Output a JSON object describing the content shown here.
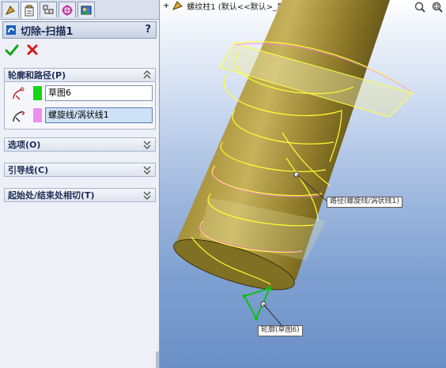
{
  "panel": {
    "tabs": [
      {
        "name": "feature-manager-tab-icon",
        "active": false
      },
      {
        "name": "property-manager-tab-icon",
        "active": true
      },
      {
        "name": "configuration-manager-tab-icon",
        "active": false
      },
      {
        "name": "dimxpert-tab-icon",
        "active": false
      },
      {
        "name": "display-manager-tab-icon",
        "active": false
      }
    ],
    "title": "切除-扫描1",
    "help": "?",
    "groups": {
      "profile_path": {
        "label": "轮廓和路径(P)",
        "profile_value": "草图6",
        "path_value": "螺旋线/涡状线1",
        "profile_color": "#16d416",
        "path_color": "#ee8ff0"
      },
      "options": {
        "label": "选项(O)"
      },
      "guides": {
        "label": "引导线(C)"
      },
      "tangency": {
        "label": "起始处/结束处相切(T)"
      }
    }
  },
  "viewport": {
    "tree_label": "螺纹柱1 (默认<<默认>_显...",
    "tree_prefix": "+",
    "path_callout": "路径(螺旋线/涡状线1)",
    "profile_callout": "轮廓(草图6)"
  },
  "colors": {
    "part": "#8a7a2c",
    "selection": "#ffff33",
    "profile_sketch": "#10c010"
  }
}
